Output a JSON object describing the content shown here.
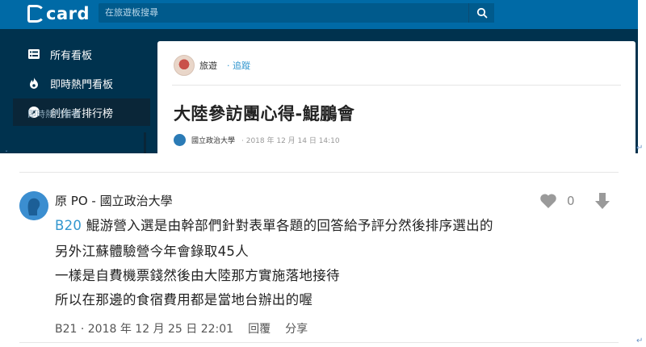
{
  "header": {
    "logo": "card",
    "search_placeholder": "在旅遊板搜尋"
  },
  "sidebar": {
    "items": [
      {
        "label": "所有看板",
        "icon": "list-icon"
      },
      {
        "label": "即時熱門看板",
        "icon": "flame-icon"
      },
      {
        "label": "創作者排行榜",
        "icon": "compass-icon"
      }
    ],
    "section": "即時熱門看板"
  },
  "post": {
    "board": "旅遊",
    "follow": "· 追蹤",
    "title": "大陸參訪團心得-鯤鵬會",
    "school": "國立政治大學",
    "date": "· 2018 年 12 月 14 日 14:10"
  },
  "comment": {
    "author": "原 PO - 國立政治大學",
    "likes": "0",
    "tag": "B20",
    "lines": [
      " 鯤游營入選是由幹部們針對表單各題的回答給予評分然後排序選出的",
      "另外江蘇體驗營今年會錄取45人",
      "一樣是自費機票錢然後由大陸那方實施落地接待",
      "所以在那邊的食宿費用都是當地台辦出的喔"
    ],
    "meta": "B21 · 2018 年 12 月 25 日 22:01",
    "reply": "回覆",
    "share": "分享"
  },
  "colors": {
    "topbar": "#006aa6",
    "sidebar": "#00324e",
    "link": "#3397cf"
  }
}
